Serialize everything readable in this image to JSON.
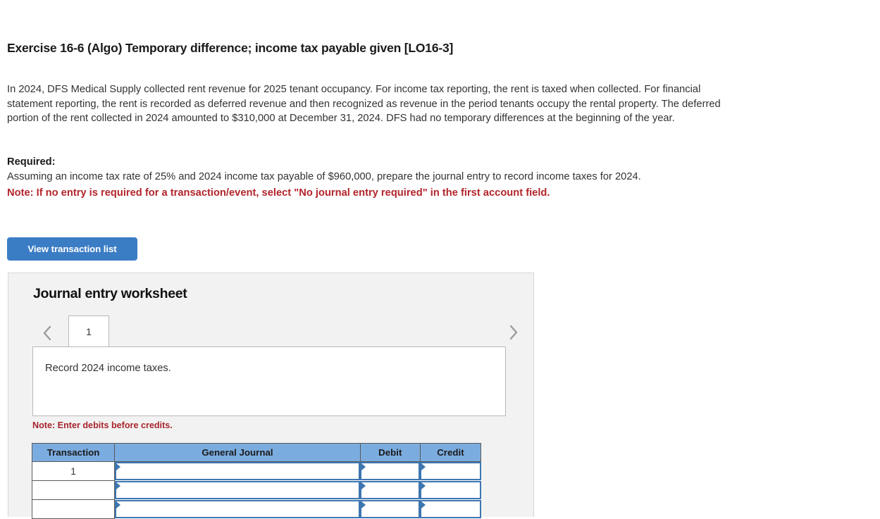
{
  "exercise": {
    "title": "Exercise 16-6 (Algo) Temporary difference; income tax payable given [LO16-3]",
    "prompt": "In 2024, DFS Medical Supply collected rent revenue for 2025 tenant occupancy. For income tax reporting, the rent is taxed when collected. For financial statement reporting, the rent is recorded as deferred revenue and then recognized as revenue in the period tenants occupy the rental property. The deferred portion of the rent collected in 2024 amounted to $310,000 at December 31, 2024. DFS had no temporary differences at the beginning of the year.",
    "required_label": "Required:",
    "required_text": "Assuming an income tax rate of 25% and 2024 income tax payable of $960,000, prepare the journal entry to record income taxes for 2024.",
    "note": "Note: If no entry is required for a transaction/event, select \"No journal entry required\" in the first account field."
  },
  "toolbar": {
    "view_transaction_list_label": "View transaction list"
  },
  "worksheet": {
    "title": "Journal entry worksheet",
    "prev_icon": "chevron-left-icon",
    "next_icon": "chevron-right-icon",
    "tabs": [
      {
        "label": "1",
        "active": true
      }
    ],
    "record_description": "Record 2024 income taxes.",
    "debit_note": "Note: Enter debits before credits.",
    "table": {
      "headers": [
        "Transaction",
        "General Journal",
        "Debit",
        "Credit"
      ],
      "rows": [
        {
          "transaction": "1",
          "general_journal": "",
          "debit": "",
          "credit": ""
        },
        {
          "transaction": "",
          "general_journal": "",
          "debit": "",
          "credit": ""
        },
        {
          "transaction": "",
          "general_journal": "",
          "debit": "",
          "credit": ""
        }
      ]
    }
  },
  "colors": {
    "button_blue": "#3b7dc4",
    "header_blue": "#7bacdf",
    "input_border_blue": "#3d76b0",
    "note_red": "#b3252b",
    "panel_gray": "#f2f2f2"
  }
}
